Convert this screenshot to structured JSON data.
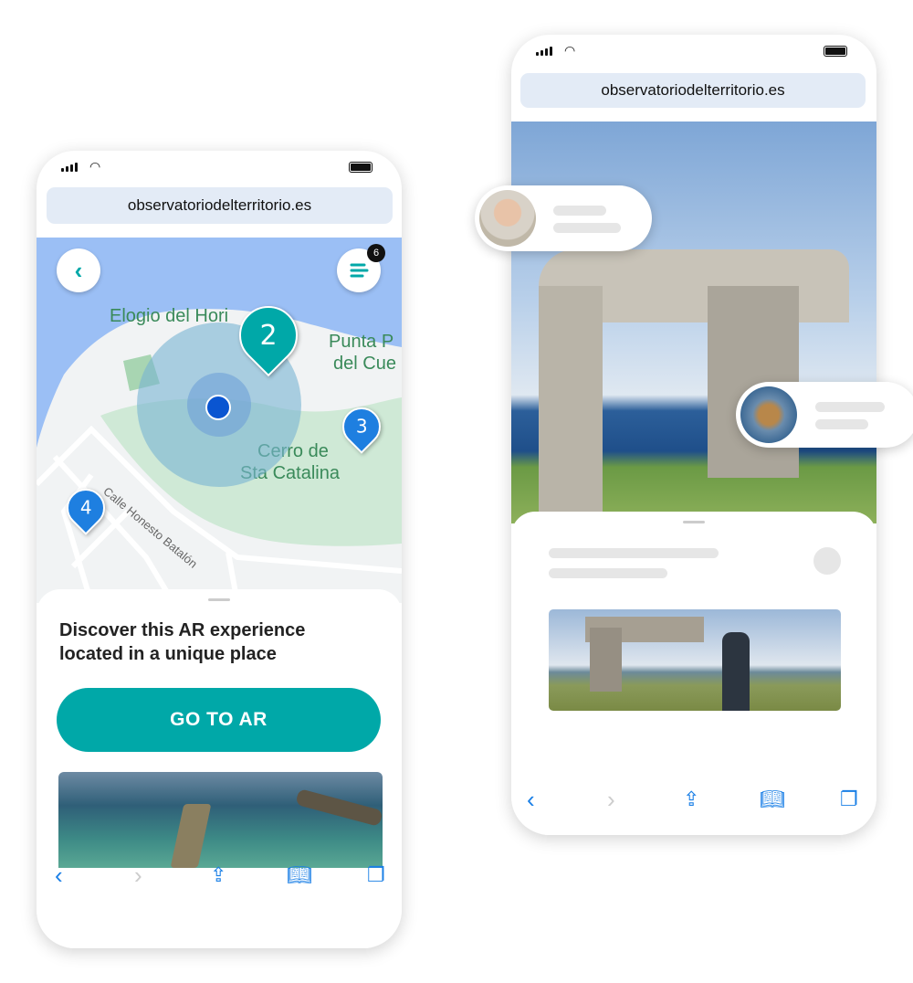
{
  "left_phone": {
    "url": "observatoriodelterritorio.es",
    "map": {
      "labels": [
        "Elogio del Hori",
        "Punta P",
        "del Cue",
        "Cerro de",
        "Sta Catalina",
        "Calle Honesto Batalón"
      ],
      "pins": [
        {
          "number": "2",
          "color": "#00a8a8"
        },
        {
          "number": "3",
          "color": "#1e7fe0"
        },
        {
          "number": "4",
          "color": "#1e7fe0"
        }
      ],
      "menu_badge": "6",
      "back_icon": "chevron-left-icon",
      "menu_icon": "menu-lines-icon"
    },
    "sheet": {
      "heading": "Discover this AR experience located in a unique place",
      "button_label": "GO TO AR"
    }
  },
  "right_phone": {
    "url": "observatoriodelterritorio.es"
  },
  "colors": {
    "accent": "#00a8a8",
    "url_bar": "#e3ebf6",
    "toolbar_icon": "#1a7fe6"
  }
}
